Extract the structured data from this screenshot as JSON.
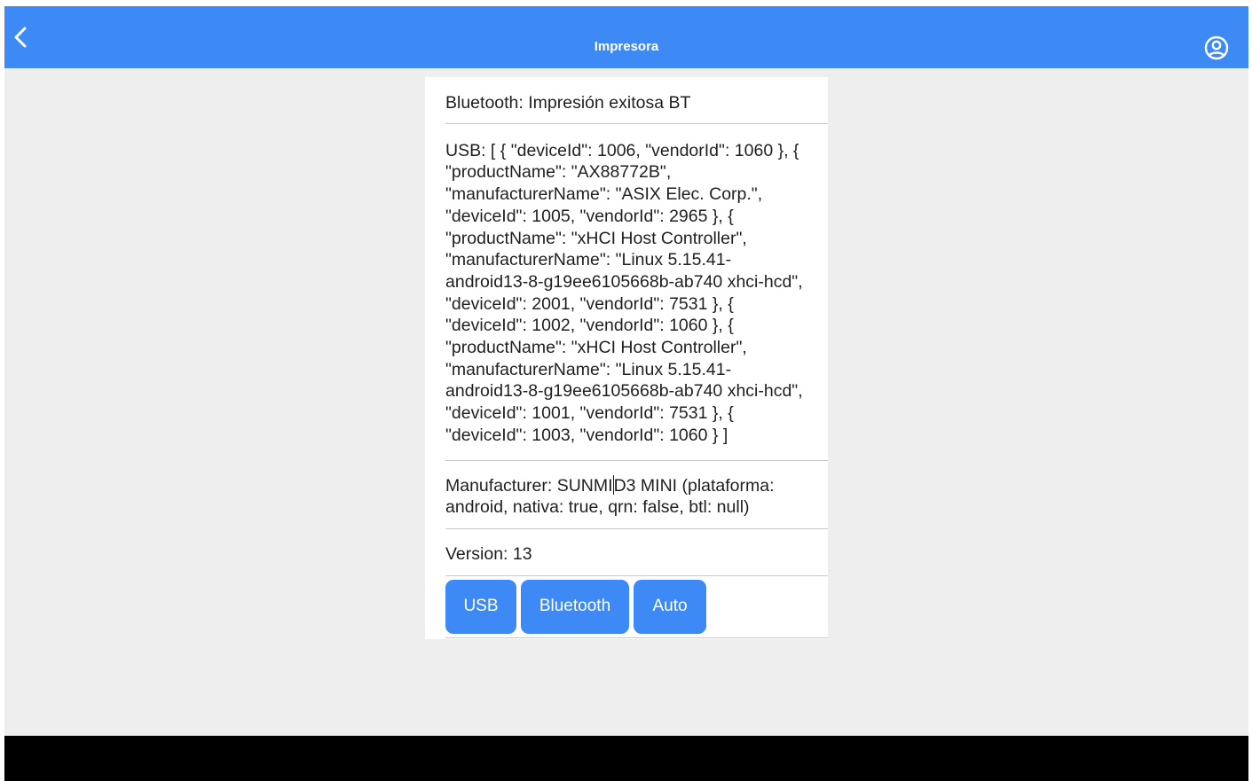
{
  "header": {
    "title": "Impresora",
    "back_icon": "chevron-left-icon",
    "account_icon": "account-circle-icon"
  },
  "info": {
    "bluetooth": "Bluetooth: Impresión exitosa BT",
    "usb": "USB: [ { \"deviceId\": 1006, \"vendorId\": 1060 }, { \"productName\": \"AX88772B\", \"manufacturerName\": \"ASIX Elec. Corp.\", \"deviceId\": 1005, \"vendorId\": 2965 }, { \"productName\": \"xHCI Host Controller\", \"manufacturerName\": \"Linux 5.15.41-android13-8-g19ee6105668b-ab740 xhci-hcd\", \"deviceId\": 2001, \"vendorId\": 7531 }, { \"deviceId\": 1002, \"vendorId\": 1060 }, { \"productName\": \"xHCI Host Controller\", \"manufacturerName\": \"Linux 5.15.41-android13-8-g19ee6105668b-ab740 xhci-hcd\", \"deviceId\": 1001, \"vendorId\": 7531 }, { \"deviceId\": 1003, \"vendorId\": 1060 } ]",
    "manufacturer_prefix": "Manufacturer: SUNMI",
    "manufacturer_suffix": "D3 MINI (plataforma: android, nativa: true, qrn: false, btl: null)",
    "version": "Version: 13"
  },
  "buttons": {
    "usb": "USB",
    "bluetooth": "Bluetooth",
    "auto": "Auto"
  },
  "colors": {
    "primary": "#3d8af7",
    "background": "#eeeeee",
    "card": "#ffffff"
  }
}
